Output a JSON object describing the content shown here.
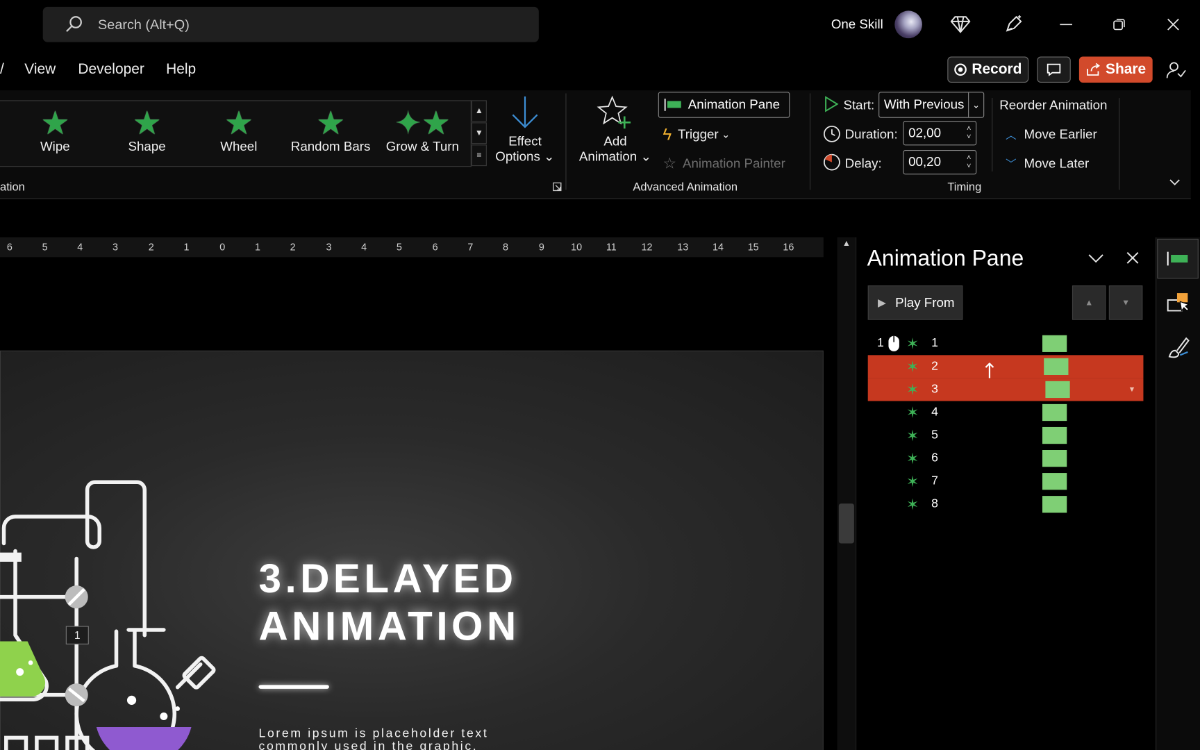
{
  "titlebar": {
    "search_placeholder": "Search (Alt+Q)",
    "user_name": "One Skill"
  },
  "menu": {
    "items": [
      "View",
      "Developer",
      "Help"
    ],
    "record_label": "Record",
    "share_label": "Share"
  },
  "ribbon": {
    "animation_gallery": [
      "Wipe",
      "Shape",
      "Wheel",
      "Random Bars",
      "Grow & Turn"
    ],
    "group_animation_partial": "ation",
    "effect_options": [
      "Effect",
      "Options"
    ],
    "add_animation": [
      "Add",
      "Animation"
    ],
    "animation_pane_btn": "Animation Pane",
    "trigger_label": "Trigger",
    "animation_painter_label": "Animation Painter",
    "group_advanced": "Advanced Animation",
    "start_label": "Start:",
    "start_value": "With Previous",
    "duration_label": "Duration:",
    "duration_value": "02,00",
    "delay_label": "Delay:",
    "delay_value": "00,20",
    "group_timing": "Timing",
    "reorder_label": "Reorder Animation",
    "move_earlier": "Move Earlier",
    "move_later": "Move Later"
  },
  "ruler": {
    "ticks": [
      "6",
      "5",
      "4",
      "3",
      "2",
      "1",
      "0",
      "1",
      "2",
      "3",
      "4",
      "5",
      "6",
      "7",
      "8",
      "9",
      "10",
      "11",
      "12",
      "13",
      "14",
      "15",
      "16"
    ]
  },
  "slide": {
    "title_line1": "3.DELAYED",
    "title_line2": "ANIMATION",
    "body_line1": "Lorem ipsum is placeholder text",
    "body_line2": "commonly used in the graphic,",
    "badge": "1"
  },
  "pane": {
    "title": "Animation Pane",
    "play_from": "Play From",
    "start_marker": "1",
    "items": [
      {
        "label": "1",
        "selected": false
      },
      {
        "label": "2",
        "selected": true
      },
      {
        "label": "3",
        "selected": true
      },
      {
        "label": "4",
        "selected": false
      },
      {
        "label": "5",
        "selected": false
      },
      {
        "label": "6",
        "selected": false
      },
      {
        "label": "7",
        "selected": false
      },
      {
        "label": "8",
        "selected": false
      }
    ]
  },
  "colors": {
    "accent_share": "#d24a2b",
    "selection": "#c6381f",
    "timeline_bar": "#7fcf75",
    "effect_green": "#2fa44a"
  }
}
